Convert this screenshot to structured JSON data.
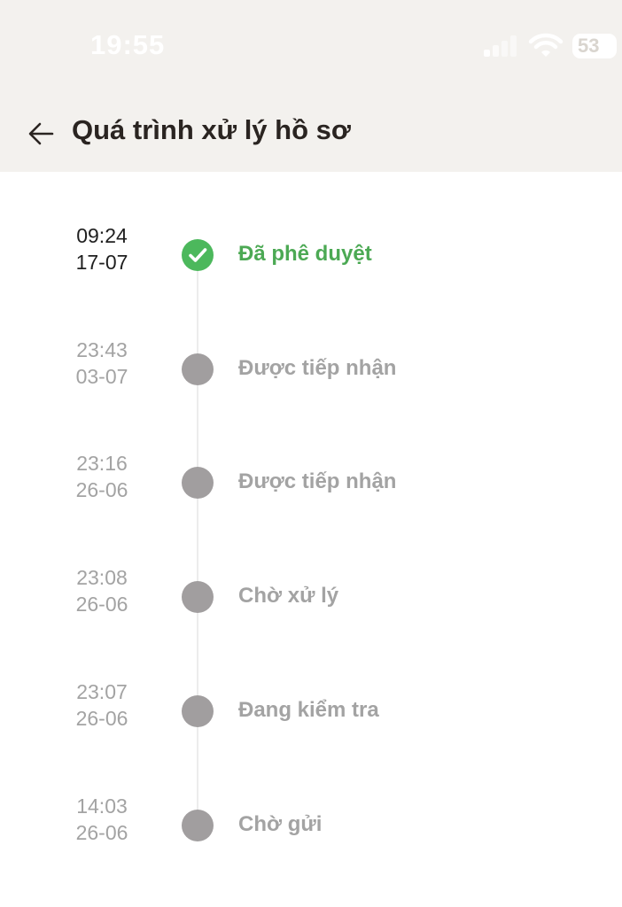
{
  "status_bar": {
    "time": "19:55",
    "battery": "53",
    "signal_icon": "cellular-signal-icon",
    "wifi_icon": "wifi-icon"
  },
  "header": {
    "back_icon": "arrow-left-icon",
    "title": "Quá trình xử lý hồ sơ"
  },
  "colors": {
    "active_green": "#4cb85c",
    "inactive_gray": "#a19e9f",
    "header_bg": "#f3f1ee"
  },
  "timeline": [
    {
      "time": "09:24",
      "date": "17-07",
      "status": "Đã phê duyệt",
      "active": true
    },
    {
      "time": "23:43",
      "date": "03-07",
      "status": "Được tiếp nhận",
      "active": false
    },
    {
      "time": "23:16",
      "date": "26-06",
      "status": "Được tiếp nhận",
      "active": false
    },
    {
      "time": "23:08",
      "date": "26-06",
      "status": "Chờ xử lý",
      "active": false
    },
    {
      "time": "23:07",
      "date": "26-06",
      "status": "Đang kiểm tra",
      "active": false
    },
    {
      "time": "14:03",
      "date": "26-06",
      "status": "Chờ gửi",
      "active": false
    }
  ]
}
